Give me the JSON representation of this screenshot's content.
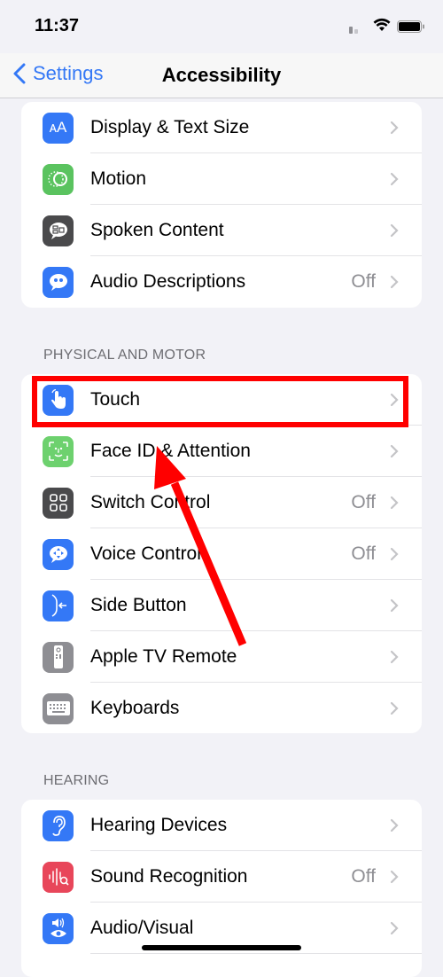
{
  "status_bar": {
    "time": "11:37"
  },
  "nav": {
    "back_label": "Settings",
    "title": "Accessibility"
  },
  "vision_group": {
    "items": [
      {
        "label": "Display & Text Size",
        "value": "",
        "icon": "text-size-icon",
        "color": "#3478f6"
      },
      {
        "label": "Motion",
        "value": "",
        "icon": "motion-icon",
        "color": "#5ac35f"
      },
      {
        "label": "Spoken Content",
        "value": "",
        "icon": "spoken-content-icon",
        "color": "#4a4a4c"
      },
      {
        "label": "Audio Descriptions",
        "value": "Off",
        "icon": "audio-descriptions-icon",
        "color": "#3478f6"
      }
    ]
  },
  "physical_group": {
    "header": "PHYSICAL AND MOTOR",
    "items": [
      {
        "label": "Touch",
        "value": "",
        "icon": "touch-icon",
        "color": "#3478f6"
      },
      {
        "label": "Face ID & Attention",
        "value": "",
        "icon": "face-id-icon",
        "color": "#5ac35f"
      },
      {
        "label": "Switch Control",
        "value": "Off",
        "icon": "switch-control-icon",
        "color": "#4a4a4c"
      },
      {
        "label": "Voice Control",
        "value": "Off",
        "icon": "voice-control-icon",
        "color": "#3478f6"
      },
      {
        "label": "Side Button",
        "value": "",
        "icon": "side-button-icon",
        "color": "#3478f6"
      },
      {
        "label": "Apple TV Remote",
        "value": "",
        "icon": "tv-remote-icon",
        "color": "#8e8e93"
      },
      {
        "label": "Keyboards",
        "value": "",
        "icon": "keyboard-icon",
        "color": "#8e8e93"
      }
    ]
  },
  "hearing_group": {
    "header": "HEARING",
    "items": [
      {
        "label": "Hearing Devices",
        "value": "",
        "icon": "ear-icon",
        "color": "#3478f6"
      },
      {
        "label": "Sound Recognition",
        "value": "Off",
        "icon": "sound-recognition-icon",
        "color": "#e8465a"
      },
      {
        "label": "Audio/Visual",
        "value": "",
        "icon": "audio-visual-icon",
        "color": "#3478f6"
      }
    ]
  },
  "annotation": {
    "highlight_target": "Touch",
    "color": "#ff0000"
  }
}
